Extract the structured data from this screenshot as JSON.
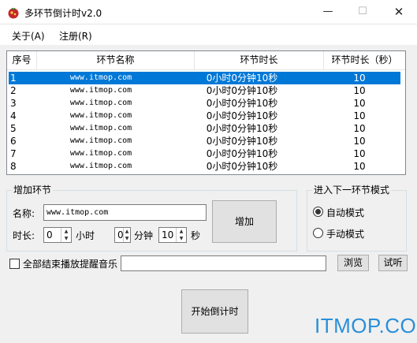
{
  "window": {
    "title": "多环节倒计时v2.0",
    "min_glyph": "—",
    "max_glyph": "☐",
    "close_glyph": "✕"
  },
  "menu": {
    "about": "关于(A)",
    "register": "注册(R)"
  },
  "list": {
    "headers": [
      "序号",
      "环节名称",
      "环节时长",
      "环节时长（秒）"
    ],
    "rows": [
      {
        "no": "1",
        "name": "www.itmop.com",
        "duration": "0小时0分钟10秒",
        "seconds": "10",
        "selected": true
      },
      {
        "no": "2",
        "name": "www.itmop.com",
        "duration": "0小时0分钟10秒",
        "seconds": "10"
      },
      {
        "no": "3",
        "name": "www.itmop.com",
        "duration": "0小时0分钟10秒",
        "seconds": "10"
      },
      {
        "no": "4",
        "name": "www.itmop.com",
        "duration": "0小时0分钟10秒",
        "seconds": "10"
      },
      {
        "no": "5",
        "name": "www.itmop.com",
        "duration": "0小时0分钟10秒",
        "seconds": "10"
      },
      {
        "no": "6",
        "name": "www.itmop.com",
        "duration": "0小时0分钟10秒",
        "seconds": "10"
      },
      {
        "no": "7",
        "name": "www.itmop.com",
        "duration": "0小时0分钟10秒",
        "seconds": "10"
      },
      {
        "no": "8",
        "name": "www.itmop.com",
        "duration": "0小时0分钟10秒",
        "seconds": "10"
      }
    ]
  },
  "add_group": {
    "title": "增加环节",
    "name_label": "名称:",
    "name_value": "www.itmop.com",
    "duration_label": "时长:",
    "hours_value": "0",
    "hours_unit": "小时",
    "minutes_value": "0",
    "minutes_unit": "分钟",
    "seconds_value": "10",
    "seconds_unit": "秒",
    "add_button": "增加"
  },
  "mode_group": {
    "title": "进入下一环节模式",
    "auto_label": "自动模式",
    "manual_label": "手动模式",
    "selected": "auto"
  },
  "music": {
    "checkbox_label": "全部结束播放提醒音乐",
    "path_value": "",
    "browse_button": "浏览",
    "test_button": "试听"
  },
  "start_button": "开始倒计时",
  "watermark": "ITMOP.COM",
  "colors": {
    "selection": "#0078d7",
    "watermark": "#2a8fd9",
    "app_icon": "#c62828"
  },
  "icons": {
    "app": "tomato-icon",
    "spin_up": "▲",
    "spin_down": "▼"
  }
}
